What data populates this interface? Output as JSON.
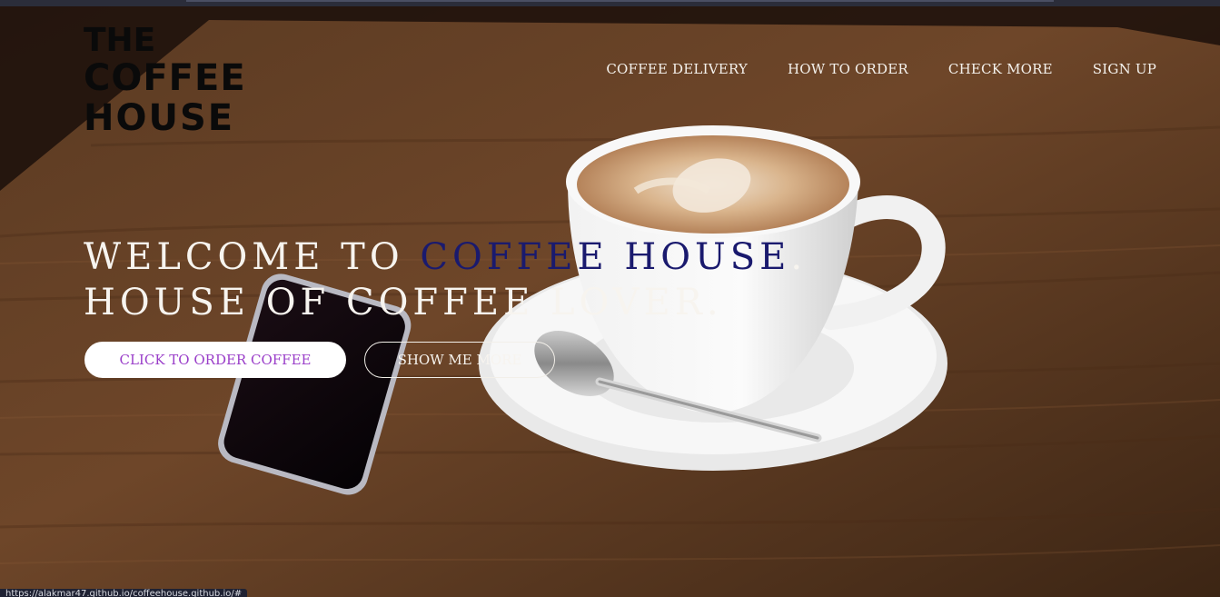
{
  "logo": {
    "line1": "THE",
    "line2": "COFFEE",
    "line3": "HOUSE"
  },
  "nav": {
    "items": [
      {
        "label": "COFFEE DELIVERY"
      },
      {
        "label": "HOW TO ORDER"
      },
      {
        "label": "CHECK MORE"
      },
      {
        "label": "SIGN UP"
      }
    ]
  },
  "hero": {
    "line1_prefix": "WELCOME TO ",
    "line1_accent": "COFFEE HOUSE",
    "line1_suffix": ".",
    "line2": "HOUSE OF COFFEE LOVER."
  },
  "buttons": {
    "primary_label": "CLICK TO ORDER COFFEE",
    "secondary_label": "SHOW ME MORE"
  },
  "status_bar": {
    "url": "https://alakmar47.github.io/coffeehouse.github.io/#"
  },
  "colors": {
    "accent": "#1a1a6e",
    "button_text": "#9a3ec9",
    "wood": "#6b4326"
  }
}
